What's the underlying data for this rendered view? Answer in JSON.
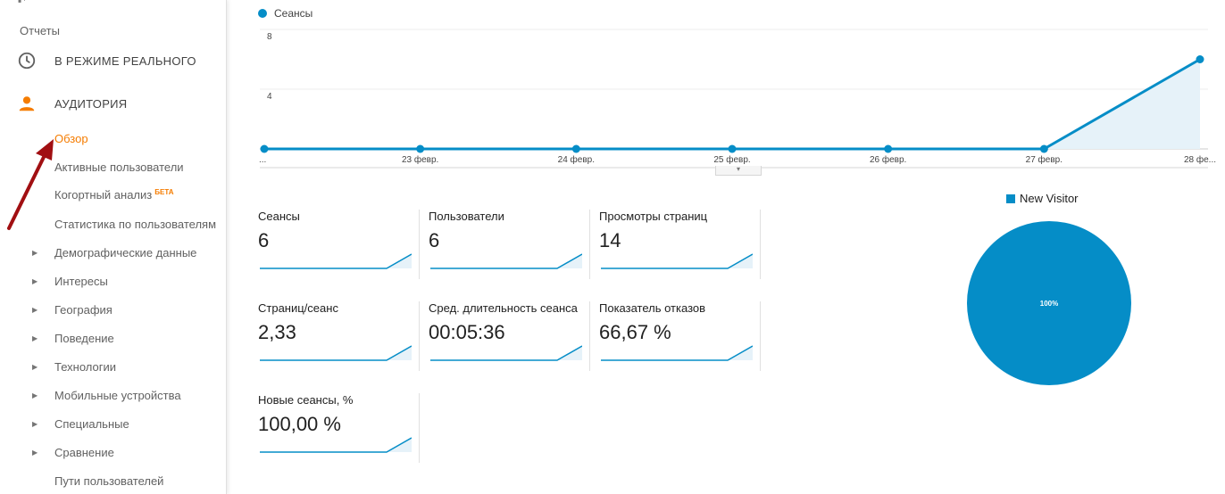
{
  "sidebar": {
    "section_title": "Отчеты",
    "realtime_label": "В РЕЖИМЕ РЕАЛЬНОГО",
    "audience_label": "АУДИТОРИЯ",
    "items": [
      {
        "label": "Обзор",
        "active": true
      },
      {
        "label": "Активные пользователи"
      },
      {
        "label": "Когортный анализ",
        "badge": "БЕТА"
      },
      {
        "label": "Статистика по пользователям"
      },
      {
        "label": "Демографические данные",
        "expandable": true
      },
      {
        "label": "Интересы",
        "expandable": true
      },
      {
        "label": "География",
        "expandable": true
      },
      {
        "label": "Поведение",
        "expandable": true
      },
      {
        "label": "Технологии",
        "expandable": true
      },
      {
        "label": "Мобильные устройства",
        "expandable": true
      },
      {
        "label": "Специальные",
        "expandable": true
      },
      {
        "label": "Сравнение",
        "expandable": true
      },
      {
        "label": "Пути пользователей"
      }
    ],
    "accent_color": "#f57c00"
  },
  "chart_data": {
    "type": "line",
    "series": [
      {
        "name": "Сеансы",
        "values": [
          0,
          0,
          0,
          0,
          0,
          0,
          6
        ]
      }
    ],
    "categories": [
      "...",
      "23 февр.",
      "24 февр.",
      "25 февр.",
      "26 февр.",
      "27 февр.",
      "28 фе..."
    ],
    "yticks": [
      "8",
      "4"
    ],
    "ylim": [
      0,
      8
    ],
    "color": "#058dc7"
  },
  "metrics": [
    {
      "label": "Сеансы",
      "value": "6"
    },
    {
      "label": "Пользователи",
      "value": "6"
    },
    {
      "label": "Просмотры страниц",
      "value": "14"
    },
    {
      "label": "Страниц/сеанс",
      "value": "2,33"
    },
    {
      "label": "Сред. длительность сеанса",
      "value": "00:05:36"
    },
    {
      "label": "Показатель отказов",
      "value": "66,67 %"
    },
    {
      "label": "Новые сеансы, %",
      "value": "100,00 %"
    }
  ],
  "pie": {
    "legend": "New Visitor",
    "slice_label": "100%",
    "value": 100,
    "color": "#058dc7"
  }
}
